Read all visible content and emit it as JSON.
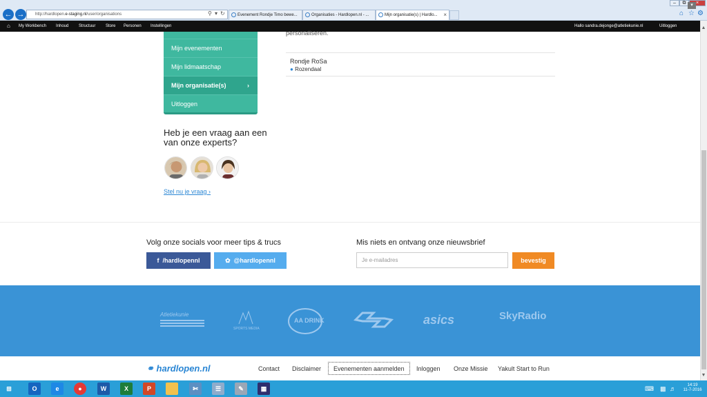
{
  "browser": {
    "url_prefix": "http://hardlopen.",
    "url_host": "e-staging.nl",
    "url_path": "/user/organisations",
    "tabs": [
      {
        "label": "Evenement Rondje Timo bewe..."
      },
      {
        "label": "Organisaties - Hardlopen.nl - ..."
      },
      {
        "label": "Mijn organisatie(s) | Hardlo..."
      }
    ]
  },
  "admin": {
    "items": [
      "My Workbench",
      "Inhoud",
      "Structuur",
      "Store",
      "Personen",
      "Instellingen"
    ],
    "greeting": "Hallo sandra.dejonge@atletiekunie.nl",
    "logout": "Uitloggen"
  },
  "sidebar": {
    "items": [
      {
        "label": "Mijn evenementen"
      },
      {
        "label": "Mijn lidmaatschap"
      },
      {
        "label": "Mijn organisatie(s)"
      },
      {
        "label": "Uitloggen"
      }
    ],
    "expert_title": "Heb je een vraag aan een van onze experts?",
    "ask_link": "Stel nu je vraag ›"
  },
  "main": {
    "partial_text": "personaliseren.",
    "organisation": {
      "name": "Rondje RoSa",
      "location": "Rozendaal"
    }
  },
  "social": {
    "title": "Volg onze socials voor meer tips & trucs",
    "facebook": "/hardlopennl",
    "twitter": "@hardlopennl",
    "facebook_color": "#3b5998",
    "twitter_color": "#55acee"
  },
  "newsletter": {
    "title": "Mis niets en ontvang onze nieuwsbrief",
    "placeholder": "Je e-mailadres",
    "button": "bevestig",
    "button_color": "#f08a24"
  },
  "sponsors": [
    "Atletiekunie",
    "SPORTS MEDIA",
    "AA DRINK",
    "NS",
    "asics",
    "SkyRadio"
  ],
  "footer": {
    "logo": "hardlopen.nl",
    "links": [
      "Contact",
      "Disclaimer",
      "Evenementen aanmelden",
      "Inloggen",
      "Onze Missie",
      "Yakult Start to Run"
    ]
  },
  "taskbar": {
    "time": "14:19",
    "date": "11-7-2016"
  }
}
